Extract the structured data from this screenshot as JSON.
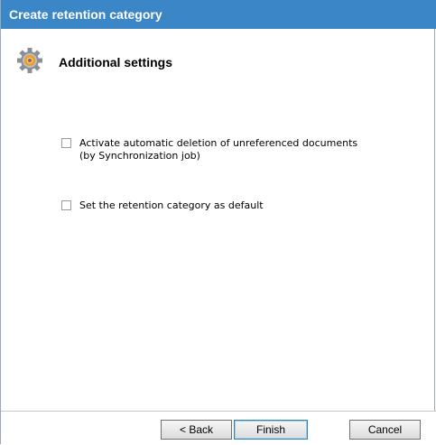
{
  "window": {
    "title": "Create retention category"
  },
  "header": {
    "icon": "gear-icon",
    "title": "Additional settings"
  },
  "options": [
    {
      "checked": false,
      "label_line1": "Activate automatic deletion of unreferenced documents",
      "label_line2": "(by Synchronization job)"
    },
    {
      "checked": false,
      "label_line1": "Set the retention category as default"
    }
  ],
  "buttons": {
    "back_label": "< Back",
    "finish_label": "Finish",
    "cancel_label": "Cancel"
  },
  "colors": {
    "titlebar": "#3a86c6",
    "title_text": "#ffffff"
  }
}
